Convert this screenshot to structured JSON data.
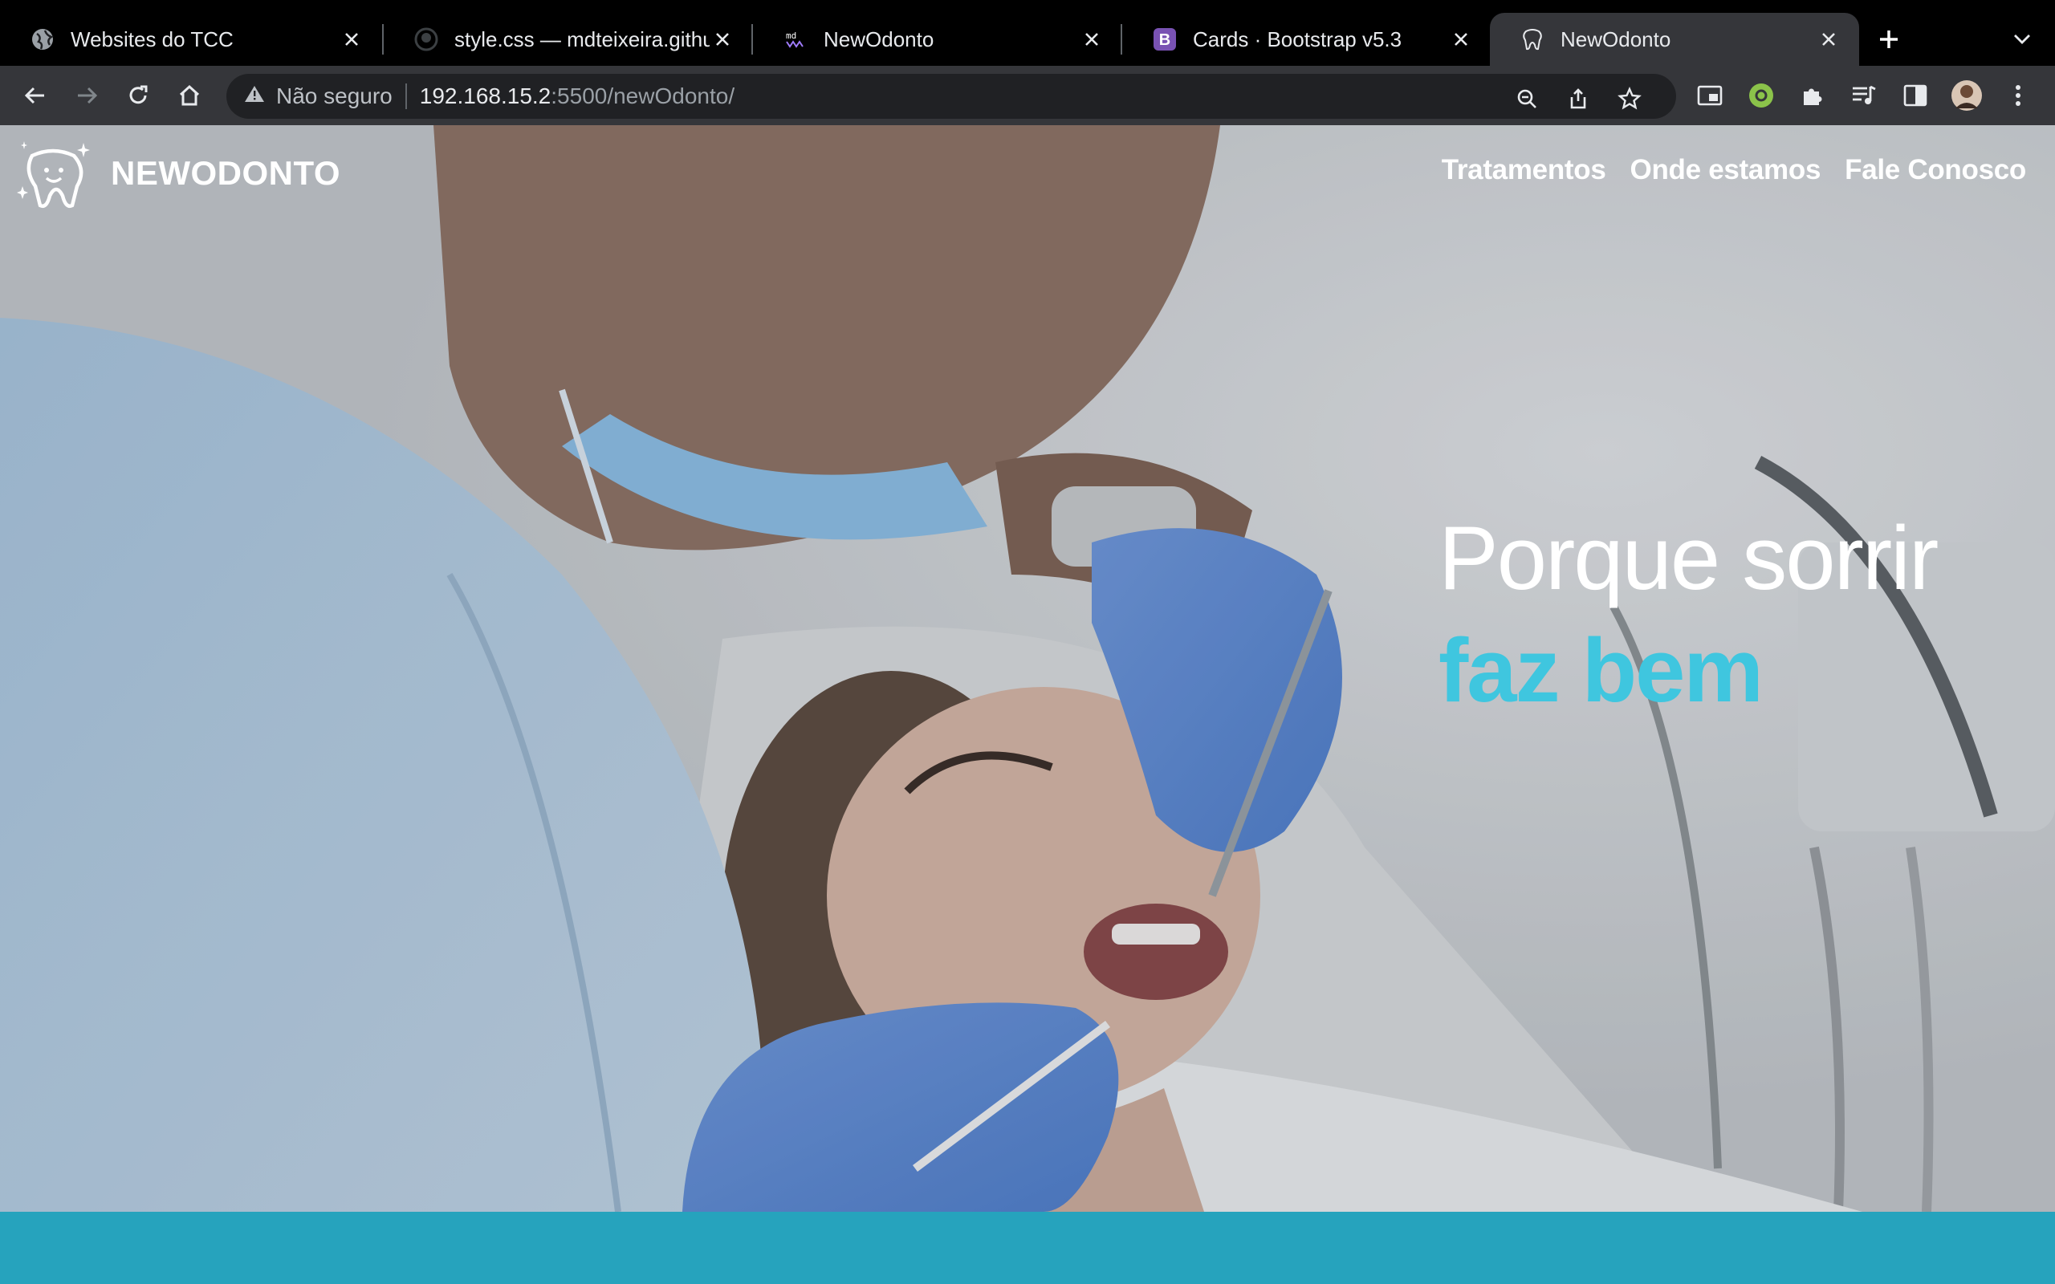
{
  "browser": {
    "tabs": [
      {
        "title": "Websites do TCC",
        "favicon": "globe-icon",
        "active": false
      },
      {
        "title": "style.css — mdteixeira.github",
        "favicon": "github-icon",
        "active": false
      },
      {
        "title": "NewOdonto",
        "favicon": "md-icon",
        "active": false
      },
      {
        "title": "Cards · Bootstrap v5.3",
        "favicon": "bootstrap-icon",
        "active": false
      },
      {
        "title": "NewOdonto",
        "favicon": "tooth-icon",
        "active": true
      }
    ],
    "address": {
      "security_label": "Não seguro",
      "host": "192.168.15.2",
      "path": ":5500/newOdonto/"
    },
    "colors": {
      "tab_strip": "#000000",
      "toolbar": "#35363a",
      "omnibox": "#202124"
    }
  },
  "site": {
    "brand": "NEWODONTO",
    "nav": [
      "Tratamentos",
      "Onde estamos",
      "Fale Conosco"
    ],
    "headline": {
      "line1": "Porque sorrir",
      "line2": "faz bem"
    },
    "colors": {
      "accent": "#3fc6df",
      "band": "#26a3bd"
    }
  }
}
